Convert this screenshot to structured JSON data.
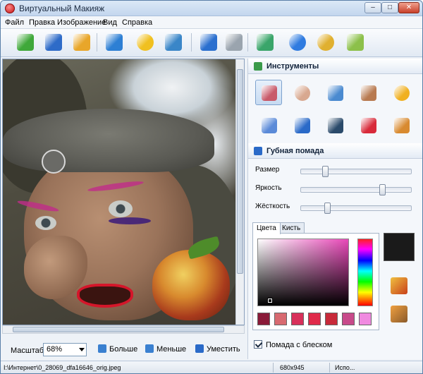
{
  "window": {
    "title": "Виртуальный Макияж",
    "minimize": "–",
    "maximize": "□",
    "close": "✕"
  },
  "menu": [
    "Файл",
    "Правка",
    "Изображение",
    "Вид",
    "Справка"
  ],
  "toolbar": {
    "icons": [
      "open-icon",
      "save-icon",
      "print-icon",
      "book-icon",
      "smiley-icon",
      "monitor-icon",
      "undo-icon",
      "redo-icon",
      "export-icon",
      "info-icon",
      "coins-icon",
      "package-icon"
    ],
    "colors": [
      "#3fa83a",
      "#2e6bc8",
      "#e8a62a",
      "#2d7fd4",
      "#f0c020",
      "#3a86c8",
      "#2a6fcf",
      "#9aa4ae",
      "#3aa56a",
      "#2f7be0",
      "#e0b030",
      "#8cc04a"
    ]
  },
  "tools_panel": {
    "title": "Инструменты",
    "tools": [
      {
        "name": "brush-icon",
        "color": "#c85a6a",
        "active": true
      },
      {
        "name": "powder-icon",
        "color": "#d8a890"
      },
      {
        "name": "palette-icon",
        "color": "#4a8ad0"
      },
      {
        "name": "foundation-icon",
        "color": "#b87a50"
      },
      {
        "name": "sun-icon",
        "color": "#f0b020"
      },
      {
        "name": "eyeshadow-icon",
        "color": "#5a8ad8"
      },
      {
        "name": "pencil-icon",
        "color": "#2a6ac8"
      },
      {
        "name": "eye-icon",
        "color": "#2a4a6a"
      },
      {
        "name": "lips-icon",
        "color": "#d82a3a"
      },
      {
        "name": "face-icon",
        "color": "#d88a30"
      }
    ]
  },
  "lipstick_panel": {
    "title": "Губная помада",
    "sliders": [
      {
        "label": "Размер",
        "value": 0.2
      },
      {
        "label": "Яркость",
        "value": 0.75
      },
      {
        "label": "Жёсткость",
        "value": 0.22
      }
    ],
    "tabs": [
      "Цвета",
      "Кисть"
    ],
    "active_tab": 0,
    "current_color": "#1a1a1a",
    "swatches": [
      "#8a1a38",
      "#d86a70",
      "#d8305a",
      "#e02a4a",
      "#c82a3a",
      "#c84a8a",
      "#f08ae0"
    ],
    "gloss_label": "Помада с блеском",
    "gloss_checked": true
  },
  "bottom": {
    "zoom_label": "Масштаб",
    "zoom_value": "68%",
    "zoom_in": "Больше",
    "zoom_out": "Меньше",
    "fit": "Уместить"
  },
  "status": {
    "path": "I:\\Интернет\\0_28069_dfa16646_orig.jpeg",
    "size": "680x945",
    "extra": "Испо..."
  }
}
